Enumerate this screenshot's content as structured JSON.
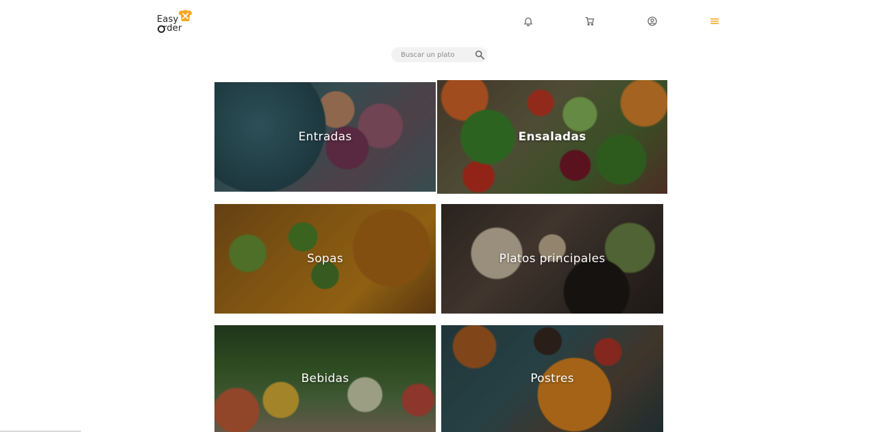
{
  "header": {
    "logo": {
      "line1": "Easy",
      "line2": "rder"
    },
    "icons": [
      {
        "name": "notifications-icon"
      },
      {
        "name": "cart-icon"
      },
      {
        "name": "account-icon"
      },
      {
        "name": "menu-icon"
      }
    ],
    "accent_color": "#f5a623"
  },
  "search": {
    "placeholder": "Buscar un plato",
    "value": ""
  },
  "categories": [
    {
      "label": "Entradas"
    },
    {
      "label": "Ensaladas"
    },
    {
      "label": "Sopas"
    },
    {
      "label": "Platos principales"
    },
    {
      "label": "Bebidas"
    },
    {
      "label": "Postres"
    }
  ]
}
